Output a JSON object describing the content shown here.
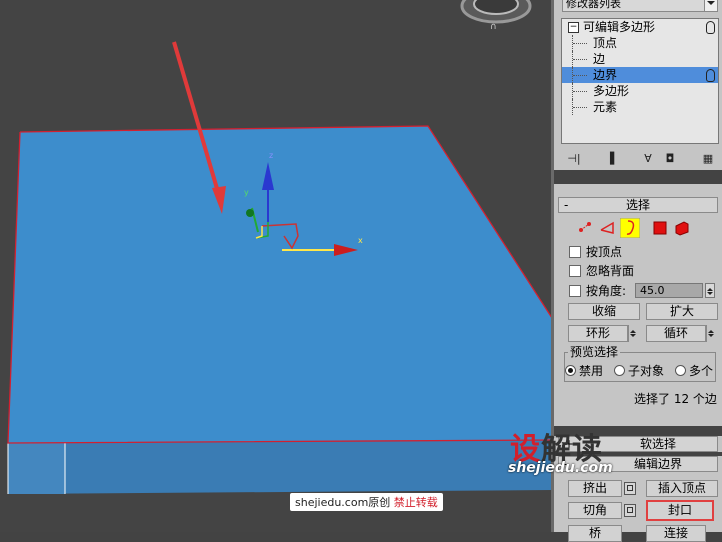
{
  "modifier_list": {
    "label": "修改器列表"
  },
  "stack": {
    "root": "可编辑多边形",
    "items": [
      {
        "label": "顶点",
        "selected": false
      },
      {
        "label": "边",
        "selected": false
      },
      {
        "label": "边界",
        "selected": true
      },
      {
        "label": "多边形",
        "selected": false
      },
      {
        "label": "元素",
        "selected": false
      }
    ]
  },
  "toolbar_icons": [
    "pin-stack-icon",
    "show-end-result-icon",
    "make-unique-icon",
    "remove-modifier-icon",
    "configure-sets-icon"
  ],
  "selection": {
    "title": "选择",
    "collapse_sign": "-",
    "by_vertex": "按顶点",
    "ignore_backfacing": "忽略背面",
    "by_angle": "按角度:",
    "angle_value": "45.0",
    "shrink": "收缩",
    "grow": "扩大",
    "ring": "环形",
    "loop": "循环",
    "preview_title": "预览选择",
    "preview_off": "禁用",
    "preview_subobject": "子对象",
    "preview_multi": "多个",
    "status": "选择了 12 个边"
  },
  "soft_selection": {
    "title": "软选择",
    "sign": "+"
  },
  "edit_borders": {
    "title": "编辑边界",
    "sign": "-",
    "extrude": "挤出",
    "insert_vertex": "插入顶点",
    "chamfer": "切角",
    "cap": "封口",
    "bridge_partial": "桥",
    "connect_partial": "连接"
  },
  "gizmo": {
    "x_label": "x",
    "y_label": "y",
    "z_label": "z"
  },
  "watermark": {
    "logo_1": "设",
    "logo_2": "解读",
    "url": "shejiedu.com",
    "credit_site": "shejiedu.com",
    "credit_original": "原创",
    "credit_notice": "禁止转载"
  },
  "colors": {
    "box_top": "#3d8dcc",
    "box_front": "#3a7cb4",
    "selected_edges": "#d22030",
    "panel_bg": "#c5c5c5",
    "stack_selected": "#4f8ddb",
    "arrow": "#e03a3a"
  }
}
